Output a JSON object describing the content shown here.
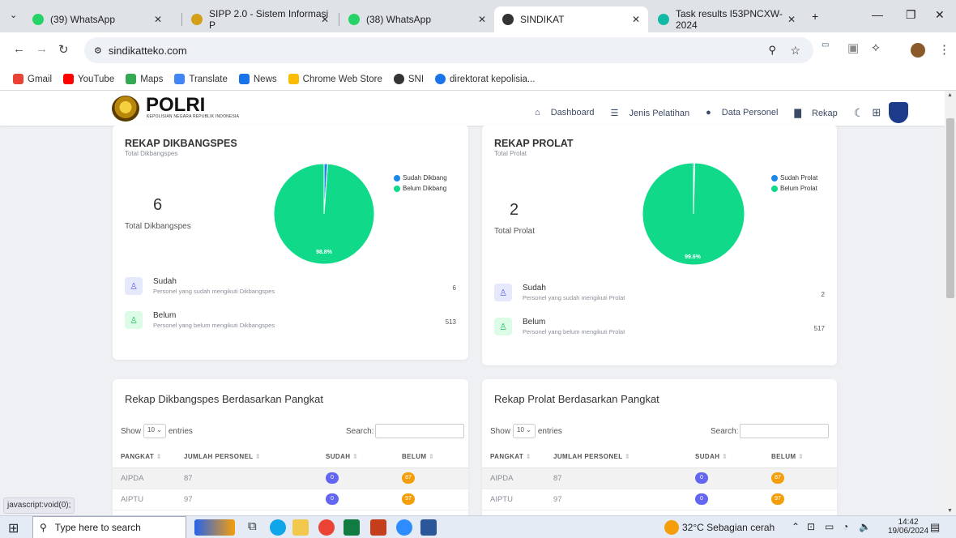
{
  "browser": {
    "tabs": [
      {
        "label": "(39) WhatsApp"
      },
      {
        "label": "SIPP 2.0 - Sistem Informasi P"
      },
      {
        "label": "(38) WhatsApp"
      },
      {
        "label": "SINDIKAT"
      },
      {
        "label": "Task results I53PNCXW-2024"
      }
    ],
    "url": "sindikatteko.com",
    "bookmarks": [
      "Gmail",
      "YouTube",
      "Maps",
      "Translate",
      "News",
      "Chrome Web Store",
      "SNI",
      "direktorat kepolisia..."
    ],
    "status_text": "javascript:void(0);"
  },
  "site": {
    "brand": "POLRI",
    "brand_sub": "KEPOLISIAN NEGARA REPUBLIK INDONESIA",
    "nav": [
      "Dashboard",
      "Jenis Pelatihan",
      "Data Personel",
      "Rekap"
    ]
  },
  "rekap_dikbangspes": {
    "title": "REKAP DIKBANGSPES",
    "subtitle": "Total Dikbangspes",
    "total": "6",
    "total_label": "Total Dikbangspes",
    "legend": [
      "Sudah Dikbang",
      "Belum Dikbang"
    ],
    "pie_label": "98.8%",
    "sudah_title": "Sudah",
    "sudah_desc": "Personel yang sudah mengikuti Dikbangspes",
    "sudah_val": "6",
    "belum_title": "Belum",
    "belum_desc": "Personel yang belum mengikuti Dikbangspes",
    "belum_val": "513"
  },
  "rekap_prolat": {
    "title": "REKAP PROLAT",
    "subtitle": "Total Prolat",
    "total": "2",
    "total_label": "Total Prolat",
    "legend": [
      "Sudah Prolat",
      "Belum Prolat"
    ],
    "pie_label": "99.6%",
    "sudah_title": "Sudah",
    "sudah_desc": "Personel yang sudah mengikuti Prolat",
    "sudah_val": "2",
    "belum_title": "Belum",
    "belum_desc": "Personel yang belum mengikuti Prolat",
    "belum_val": "517"
  },
  "chart_data": [
    {
      "type": "pie",
      "categories": [
        "Sudah Dikbang",
        "Belum Dikbang"
      ],
      "values": [
        6,
        513
      ],
      "colors": [
        "#1e88e5",
        "#10d98a"
      ]
    },
    {
      "type": "pie",
      "categories": [
        "Sudah Prolat",
        "Belum Prolat"
      ],
      "values": [
        2,
        517
      ],
      "colors": [
        "#1e88e5",
        "#10d98a"
      ]
    }
  ],
  "table_dik": {
    "title": "Rekap Dikbangspes Berdasarkan Pangkat",
    "show": "Show",
    "entries": "entries",
    "select": "10",
    "search": "Search:",
    "headers": [
      "PANGKAT",
      "JUMLAH PERSONEL",
      "SUDAH",
      "BELUM"
    ],
    "rows": [
      [
        "AIPDA",
        "87",
        "0",
        "87"
      ],
      [
        "AIPTU",
        "97",
        "0",
        "97"
      ]
    ]
  },
  "table_pro": {
    "title": "Rekap Prolat Berdasarkan Pangkat",
    "show": "Show",
    "entries": "entries",
    "select": "10",
    "search": "Search:",
    "headers": [
      "PANGKAT",
      "JUMLAH PERSONEL",
      "SUDAH",
      "BELUM"
    ],
    "rows": [
      [
        "AIPDA",
        "87",
        "0",
        "87"
      ],
      [
        "AIPTU",
        "97",
        "0",
        "97"
      ]
    ]
  },
  "taskbar": {
    "search_placeholder": "Type here to search",
    "weather": "32°C  Sebagian cerah",
    "time": "14:42",
    "date": "19/06/2024"
  }
}
